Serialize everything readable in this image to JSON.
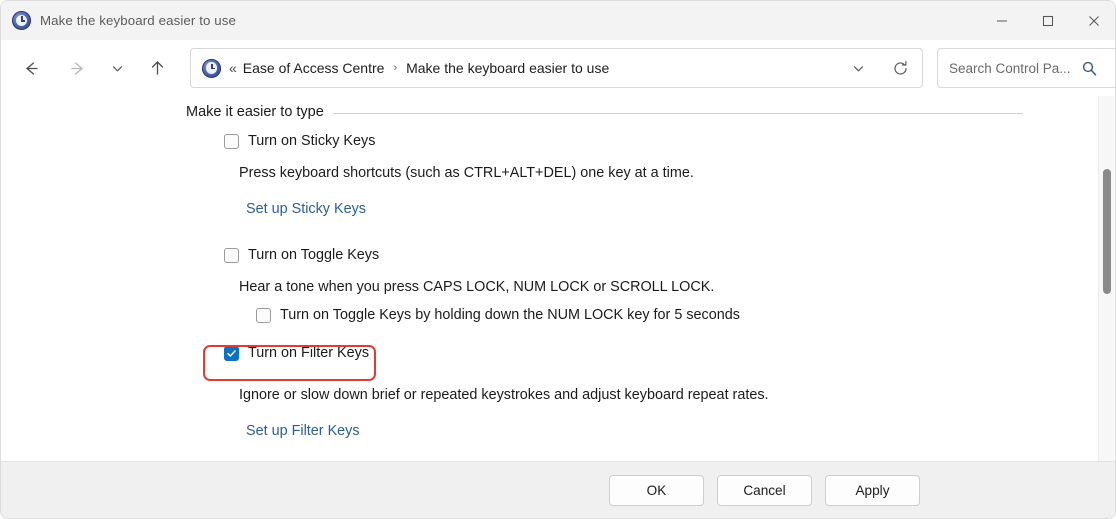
{
  "window": {
    "title": "Make the keyboard easier to use",
    "title_icon": "ease-of-access-icon",
    "controls": {
      "minimize": "minimize-icon",
      "maximize": "maximize-icon",
      "close": "close-icon"
    }
  },
  "toolbar": {
    "back": "back-arrow-icon",
    "forward": "forward-arrow-icon",
    "recent": "chevron-down-icon",
    "up": "up-arrow-icon",
    "breadcrumb": {
      "icon": "ease-of-access-icon",
      "overflow": "«",
      "items": [
        {
          "label": "Ease of Access Centre"
        },
        {
          "label": "Make the keyboard easier to use"
        }
      ],
      "separator": "›",
      "dropdown": "chevron-down-icon",
      "refresh": "refresh-icon"
    },
    "search": {
      "placeholder": "Search Control Pa...",
      "value": "",
      "icon": "search-icon"
    }
  },
  "content": {
    "group_heading": "Make it easier to type",
    "sections": [
      {
        "checkbox_label": "Turn on Sticky Keys",
        "checked": false,
        "description": "Press keyboard shortcuts (such as CTRL+ALT+DEL) one key at a time.",
        "link": "Set up Sticky Keys"
      },
      {
        "checkbox_label": "Turn on Toggle Keys",
        "checked": false,
        "description": "Hear a tone when you press CAPS LOCK, NUM LOCK or SCROLL LOCK.",
        "sub_checkbox_label": "Turn on Toggle Keys by holding down the NUM LOCK key for 5 seconds",
        "sub_checked": false
      },
      {
        "checkbox_label": "Turn on Filter Keys",
        "checked": true,
        "highlighted": true,
        "description": "Ignore or slow down brief or repeated keystrokes and adjust keyboard repeat rates.",
        "link": "Set up Filter Keys"
      }
    ]
  },
  "footer": {
    "ok": "OK",
    "cancel": "Cancel",
    "apply": "Apply"
  },
  "colors": {
    "accent_checkbox": "#0a71c8",
    "link": "#2c5d94",
    "highlight_box": "#e23b33",
    "titlebar_bg": "#f3f3f3",
    "footer_bg": "#f0f0f0"
  }
}
